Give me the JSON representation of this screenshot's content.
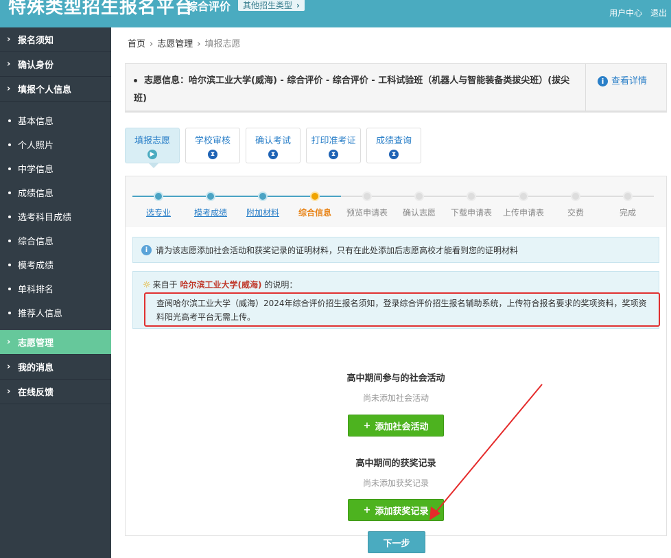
{
  "header": {
    "title": "特殊类型招生报名平台",
    "subtitle": "综合评价",
    "type_button": "其他招生类型",
    "user_center": "用户中心",
    "logout": "退出"
  },
  "sidebar": {
    "items_top": [
      {
        "label": "报名须知"
      },
      {
        "label": "确认身份"
      },
      {
        "label": "填报个人信息"
      }
    ],
    "sub_items": [
      {
        "label": "基本信息"
      },
      {
        "label": "个人照片"
      },
      {
        "label": "中学信息"
      },
      {
        "label": "成绩信息"
      },
      {
        "label": "选考科目成绩"
      },
      {
        "label": "综合信息"
      },
      {
        "label": "模考成绩"
      },
      {
        "label": "单科排名"
      },
      {
        "label": "推荐人信息"
      }
    ],
    "items_bottom": [
      {
        "label": "志愿管理",
        "active": true
      },
      {
        "label": "我的消息"
      },
      {
        "label": "在线反馈"
      }
    ]
  },
  "breadcrumb": {
    "home": "首页",
    "level1": "志愿管理",
    "current": "填报志愿"
  },
  "info": {
    "text": "志愿信息：哈尔滨工业大学(威海) - 综合评价 - 综合评价 - 工科试验班（机器人与智能装备类拔尖班）(拔尖班)",
    "detail_link": "查看详情"
  },
  "tabs": [
    {
      "label": "填报志愿",
      "active": true
    },
    {
      "label": "学校审核"
    },
    {
      "label": "确认考试"
    },
    {
      "label": "打印准考证"
    },
    {
      "label": "成绩查询"
    }
  ],
  "steps": [
    {
      "label": "选专业",
      "state": "done"
    },
    {
      "label": "模考成绩",
      "state": "done"
    },
    {
      "label": "附加材料",
      "state": "done"
    },
    {
      "label": "综合信息",
      "state": "current"
    },
    {
      "label": "预览申请表",
      "state": "todo"
    },
    {
      "label": "确认志愿",
      "state": "todo"
    },
    {
      "label": "下载申请表",
      "state": "todo"
    },
    {
      "label": "上传申请表",
      "state": "todo"
    },
    {
      "label": "交费",
      "state": "todo"
    },
    {
      "label": "完成",
      "state": "todo"
    }
  ],
  "notice": {
    "text": "请为该志愿添加社会活动和获奖记录的证明材料，只有在此处添加后志愿高校才能看到您的证明材料"
  },
  "explain": {
    "prefix": "来自于",
    "school": "哈尔滨工业大学(威海)",
    "suffix": "的说明：",
    "body": "查阅哈尔滨工业大学（威海）2024年综合评价招生报名须知，登录综合评价招生报名辅助系统，上传符合报名要求的奖项资料，奖项资料阳光高考平台无需上传。"
  },
  "social": {
    "title": "高中期间参与的社会活动",
    "empty": "尚未添加社会活动",
    "button": "添加社会活动"
  },
  "awards": {
    "title": "高中期间的获奖记录",
    "empty": "尚未添加获奖记录",
    "button": "添加获奖记录"
  },
  "next_button": "下一步",
  "colors": {
    "header": "#4aabc0",
    "sidebar": "#323d46",
    "sidebar_active": "#66c89b",
    "link": "#2a7fc8",
    "green_button": "#4db31f",
    "highlight_border": "#e03030"
  }
}
